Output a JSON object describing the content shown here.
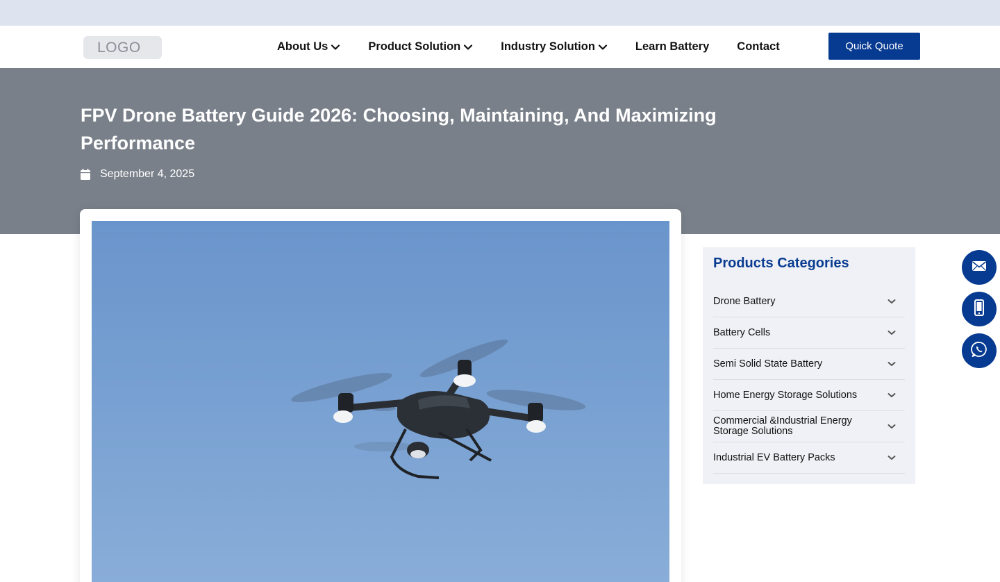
{
  "logo": {
    "text": "LOGO"
  },
  "nav": {
    "items": [
      {
        "label": "About Us",
        "has_dropdown": true
      },
      {
        "label": "Product Solution",
        "has_dropdown": true
      },
      {
        "label": "Industry Solution",
        "has_dropdown": true
      },
      {
        "label": "Learn Battery",
        "has_dropdown": false
      },
      {
        "label": "Contact",
        "has_dropdown": false
      }
    ],
    "cta_label": "Quick Quote"
  },
  "article": {
    "title": "FPV Drone Battery Guide 2026: Choosing, Maintaining, And Maximizing Performance",
    "date": "September 4, 2025",
    "date_icon": "calendar-icon",
    "hero_image": "drone-in-blue-sky"
  },
  "sidebar": {
    "title": "Products Categories",
    "items": [
      {
        "label": "Drone Battery"
      },
      {
        "label": "Battery Cells"
      },
      {
        "label": "Semi Solid State Battery"
      },
      {
        "label": "Home Energy Storage Solutions"
      },
      {
        "label": "Commercial &Industrial Energy Storage Solutions"
      },
      {
        "label": "Industrial EV Battery Packs"
      }
    ]
  },
  "floating_contacts": [
    {
      "icon": "email-icon"
    },
    {
      "icon": "phone-icon"
    },
    {
      "icon": "whatsapp-icon"
    }
  ],
  "colors": {
    "brand_blue": "#073a91",
    "heading_blue": "#0a3d91",
    "hero_gray": "#7a808a",
    "topbar": "#dde3ef",
    "sidebar_bg": "#eff1f6"
  }
}
